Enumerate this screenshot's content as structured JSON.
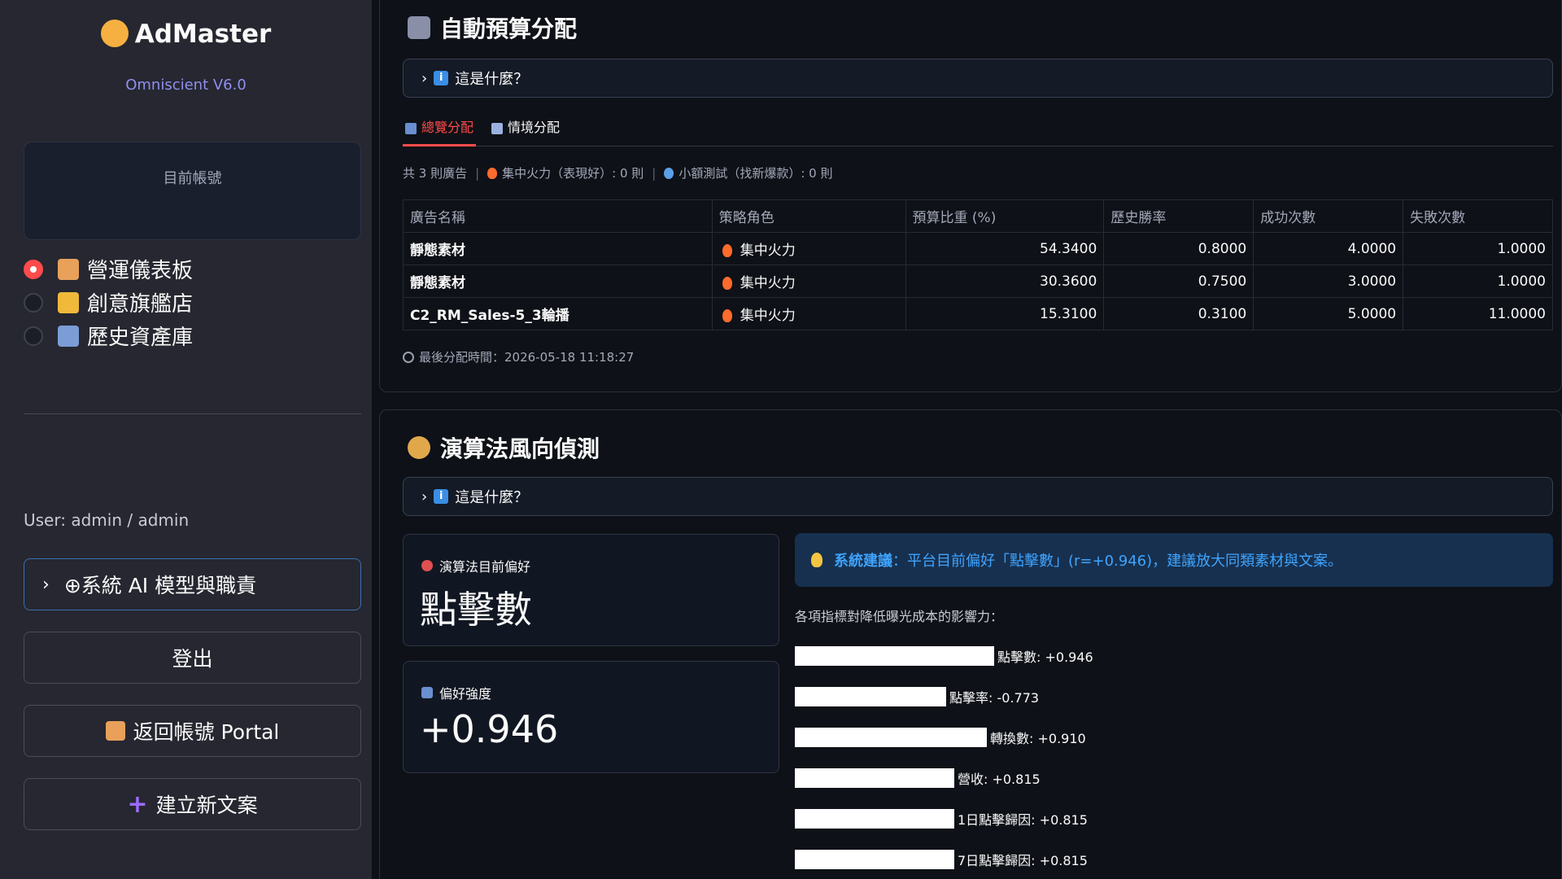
{
  "sidebar": {
    "brand": "AdMaster",
    "version": "Omniscient V6.0",
    "account_label": "目前帳號",
    "nav": [
      {
        "label": "營運儀表板",
        "selected": true
      },
      {
        "label": "創意旗艦店",
        "selected": false
      },
      {
        "label": "歷史資產庫",
        "selected": false
      }
    ],
    "user": "User: admin / admin",
    "ai_expander": "⊕系統 AI 模型與職責",
    "logout": "登出",
    "back_portal": "返回帳號 Portal",
    "new_copy": "建立新文案"
  },
  "budget": {
    "title": "自動預算分配",
    "expander": "這是什麼？",
    "tabs": [
      "總覽分配",
      "情境分配"
    ],
    "summary": {
      "total": "共 3 則廣告",
      "focus": "集中火力（表現好）: 0 則",
      "test": "小額測試（找新爆款）: 0 則"
    },
    "table": {
      "headers": [
        "廣告名稱",
        "策略角色",
        "預算比重 (%)",
        "歷史勝率",
        "成功次數",
        "失敗次數"
      ],
      "rows": [
        [
          "靜態素材",
          "集中火力",
          "54.3400",
          "0.8000",
          "4.0000",
          "1.0000"
        ],
        [
          "靜態素材",
          "集中火力",
          "30.3600",
          "0.7500",
          "3.0000",
          "1.0000"
        ],
        [
          "C2_RM_Sales-5_3輪播",
          "集中火力",
          "15.3100",
          "0.3100",
          "5.0000",
          "11.0000"
        ]
      ]
    },
    "last_time": "最後分配時間：2026-05-18 11:18:27"
  },
  "algo": {
    "title": "演算法風向偵測",
    "expander": "這是什麼？",
    "pref_label": "演算法目前偏好",
    "pref_value": "點擊數",
    "strength_label": "偏好強度",
    "strength_value": "+0.946",
    "alert_bold": "系統建議",
    "alert_text": "：平台目前偏好「點擊數」(r=+0.946)，建議放大同類素材與文案。",
    "impact_title": "各項指標對降低曝光成本的影響力：",
    "bars": [
      {
        "label": "點擊數: +0.946",
        "value": 0.946
      },
      {
        "label": "點擊率: -0.773",
        "value": -0.773
      },
      {
        "label": "轉換數: +0.910",
        "value": 0.91
      },
      {
        "label": "營收: +0.815",
        "value": 0.815
      },
      {
        "label": "1日點擊歸因: +0.815",
        "value": 0.815
      },
      {
        "label": "7日點擊歸因: +0.815",
        "value": 0.815
      }
    ]
  }
}
